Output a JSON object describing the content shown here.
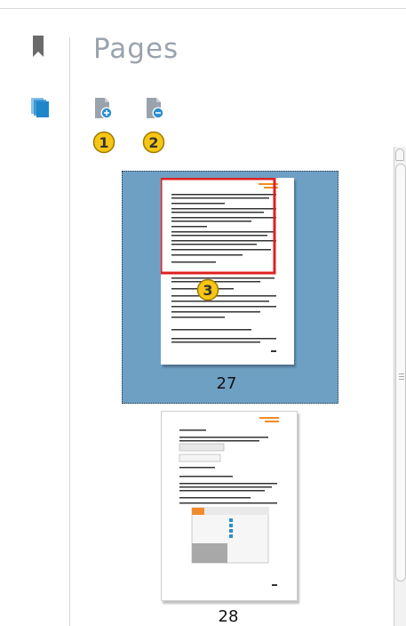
{
  "panel": {
    "title": "Pages",
    "side_icons": [
      "bookmark-icon",
      "pages-icon"
    ],
    "toolbar": [
      {
        "name": "zoom-in-page",
        "icon": "page-zoom-in-icon"
      },
      {
        "name": "zoom-out-page",
        "icon": "page-zoom-out-icon"
      }
    ]
  },
  "callouts": [
    "1",
    "2",
    "3"
  ],
  "thumbnails": [
    {
      "page": "27",
      "selected": true
    },
    {
      "page": "28",
      "selected": false
    }
  ],
  "colors": {
    "selection_bg": "#6ea0c3",
    "callout_fill": "#f7c515",
    "highlight_rect": "#e02020",
    "page_accent": "#f28c2a",
    "icon_blue": "#2a8fd1"
  }
}
